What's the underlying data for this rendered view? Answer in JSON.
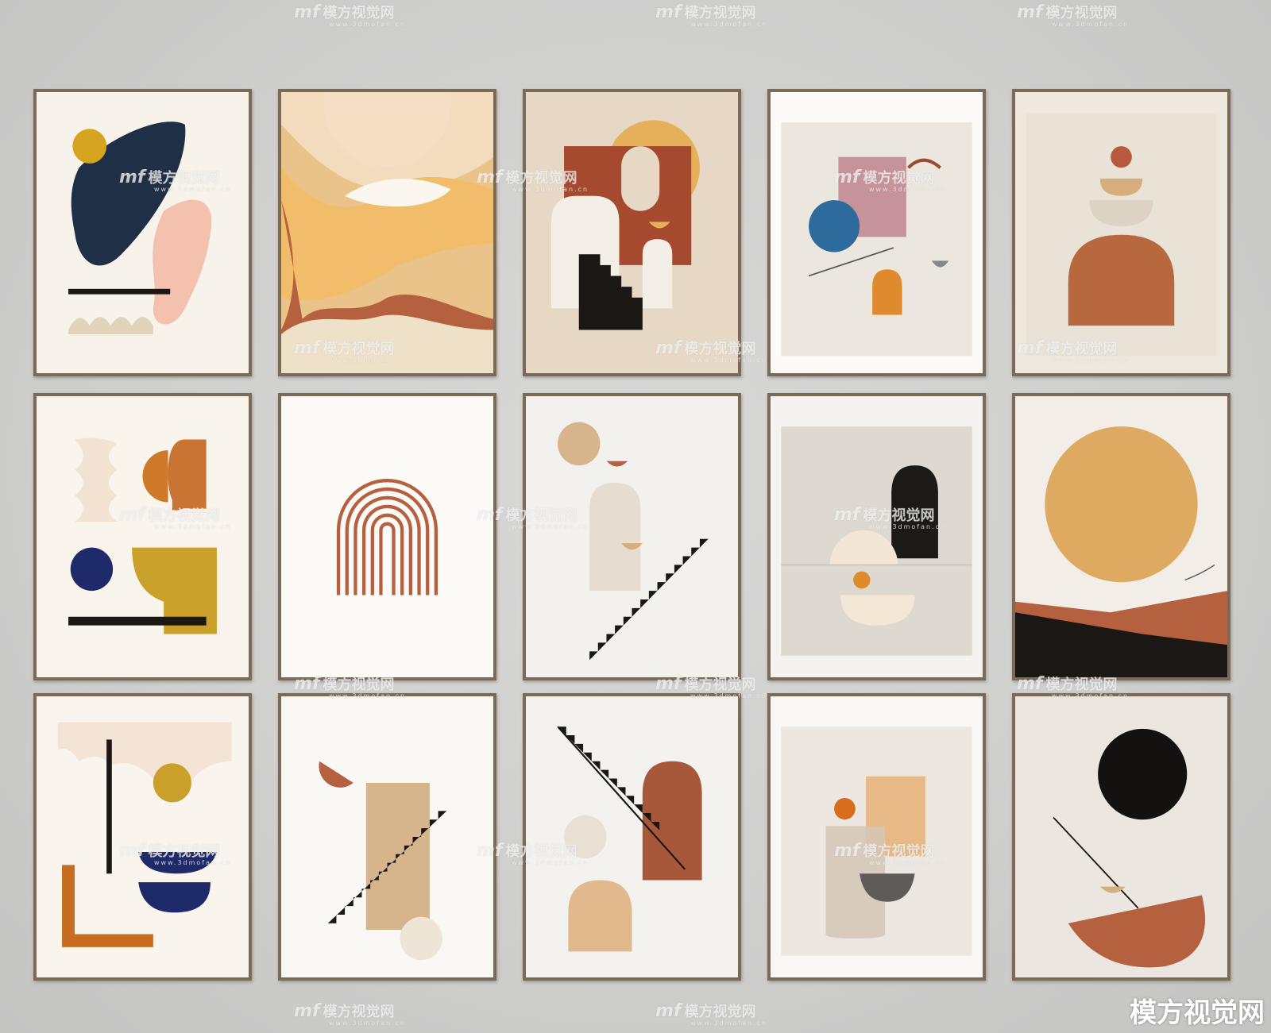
{
  "watermark": {
    "logo": "mf",
    "name": "模方视觉网",
    "url": "www.3dmofan.cn"
  },
  "brand_mark": "模方视觉网",
  "colors": {
    "wall": "#d3d3d2",
    "frame": "#7b6a57",
    "terracotta": "#b5603e",
    "ochre": "#d9a34a",
    "mustard": "#c9a02a",
    "navy": "#1f2a6b",
    "black": "#1b1715",
    "blush": "#f2c4b4",
    "sand": "#d6b58c"
  },
  "artworks": [
    {
      "name": "dark-stone-yellow-dot"
    },
    {
      "name": "layered-dunes"
    },
    {
      "name": "arches-and-stairs"
    },
    {
      "name": "pink-square-blue-circle"
    },
    {
      "name": "stacked-bowls"
    },
    {
      "name": "orange-half-circles"
    },
    {
      "name": "rainbow-arch"
    },
    {
      "name": "diagonal-staircase"
    },
    {
      "name": "black-arch-gray-panel"
    },
    {
      "name": "sun-over-hills"
    },
    {
      "name": "navy-bowls"
    },
    {
      "name": "tan-rectangle-stairs"
    },
    {
      "name": "stairs-and-brown-arch"
    },
    {
      "name": "overlapping-squares"
    },
    {
      "name": "black-moon-red-bowl"
    }
  ]
}
